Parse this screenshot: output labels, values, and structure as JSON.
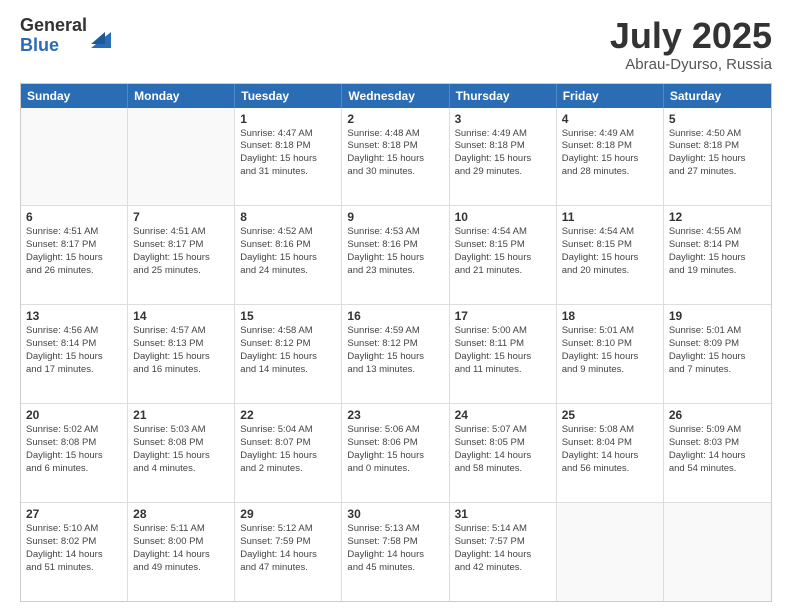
{
  "logo": {
    "general": "General",
    "blue": "Blue"
  },
  "title": {
    "month_year": "July 2025",
    "location": "Abrau-Dyurso, Russia"
  },
  "header_days": [
    "Sunday",
    "Monday",
    "Tuesday",
    "Wednesday",
    "Thursday",
    "Friday",
    "Saturday"
  ],
  "weeks": [
    [
      {
        "day": "",
        "info": ""
      },
      {
        "day": "",
        "info": ""
      },
      {
        "day": "1",
        "info": "Sunrise: 4:47 AM\nSunset: 8:18 PM\nDaylight: 15 hours\nand 31 minutes."
      },
      {
        "day": "2",
        "info": "Sunrise: 4:48 AM\nSunset: 8:18 PM\nDaylight: 15 hours\nand 30 minutes."
      },
      {
        "day": "3",
        "info": "Sunrise: 4:49 AM\nSunset: 8:18 PM\nDaylight: 15 hours\nand 29 minutes."
      },
      {
        "day": "4",
        "info": "Sunrise: 4:49 AM\nSunset: 8:18 PM\nDaylight: 15 hours\nand 28 minutes."
      },
      {
        "day": "5",
        "info": "Sunrise: 4:50 AM\nSunset: 8:18 PM\nDaylight: 15 hours\nand 27 minutes."
      }
    ],
    [
      {
        "day": "6",
        "info": "Sunrise: 4:51 AM\nSunset: 8:17 PM\nDaylight: 15 hours\nand 26 minutes."
      },
      {
        "day": "7",
        "info": "Sunrise: 4:51 AM\nSunset: 8:17 PM\nDaylight: 15 hours\nand 25 minutes."
      },
      {
        "day": "8",
        "info": "Sunrise: 4:52 AM\nSunset: 8:16 PM\nDaylight: 15 hours\nand 24 minutes."
      },
      {
        "day": "9",
        "info": "Sunrise: 4:53 AM\nSunset: 8:16 PM\nDaylight: 15 hours\nand 23 minutes."
      },
      {
        "day": "10",
        "info": "Sunrise: 4:54 AM\nSunset: 8:15 PM\nDaylight: 15 hours\nand 21 minutes."
      },
      {
        "day": "11",
        "info": "Sunrise: 4:54 AM\nSunset: 8:15 PM\nDaylight: 15 hours\nand 20 minutes."
      },
      {
        "day": "12",
        "info": "Sunrise: 4:55 AM\nSunset: 8:14 PM\nDaylight: 15 hours\nand 19 minutes."
      }
    ],
    [
      {
        "day": "13",
        "info": "Sunrise: 4:56 AM\nSunset: 8:14 PM\nDaylight: 15 hours\nand 17 minutes."
      },
      {
        "day": "14",
        "info": "Sunrise: 4:57 AM\nSunset: 8:13 PM\nDaylight: 15 hours\nand 16 minutes."
      },
      {
        "day": "15",
        "info": "Sunrise: 4:58 AM\nSunset: 8:12 PM\nDaylight: 15 hours\nand 14 minutes."
      },
      {
        "day": "16",
        "info": "Sunrise: 4:59 AM\nSunset: 8:12 PM\nDaylight: 15 hours\nand 13 minutes."
      },
      {
        "day": "17",
        "info": "Sunrise: 5:00 AM\nSunset: 8:11 PM\nDaylight: 15 hours\nand 11 minutes."
      },
      {
        "day": "18",
        "info": "Sunrise: 5:01 AM\nSunset: 8:10 PM\nDaylight: 15 hours\nand 9 minutes."
      },
      {
        "day": "19",
        "info": "Sunrise: 5:01 AM\nSunset: 8:09 PM\nDaylight: 15 hours\nand 7 minutes."
      }
    ],
    [
      {
        "day": "20",
        "info": "Sunrise: 5:02 AM\nSunset: 8:08 PM\nDaylight: 15 hours\nand 6 minutes."
      },
      {
        "day": "21",
        "info": "Sunrise: 5:03 AM\nSunset: 8:08 PM\nDaylight: 15 hours\nand 4 minutes."
      },
      {
        "day": "22",
        "info": "Sunrise: 5:04 AM\nSunset: 8:07 PM\nDaylight: 15 hours\nand 2 minutes."
      },
      {
        "day": "23",
        "info": "Sunrise: 5:06 AM\nSunset: 8:06 PM\nDaylight: 15 hours\nand 0 minutes."
      },
      {
        "day": "24",
        "info": "Sunrise: 5:07 AM\nSunset: 8:05 PM\nDaylight: 14 hours\nand 58 minutes."
      },
      {
        "day": "25",
        "info": "Sunrise: 5:08 AM\nSunset: 8:04 PM\nDaylight: 14 hours\nand 56 minutes."
      },
      {
        "day": "26",
        "info": "Sunrise: 5:09 AM\nSunset: 8:03 PM\nDaylight: 14 hours\nand 54 minutes."
      }
    ],
    [
      {
        "day": "27",
        "info": "Sunrise: 5:10 AM\nSunset: 8:02 PM\nDaylight: 14 hours\nand 51 minutes."
      },
      {
        "day": "28",
        "info": "Sunrise: 5:11 AM\nSunset: 8:00 PM\nDaylight: 14 hours\nand 49 minutes."
      },
      {
        "day": "29",
        "info": "Sunrise: 5:12 AM\nSunset: 7:59 PM\nDaylight: 14 hours\nand 47 minutes."
      },
      {
        "day": "30",
        "info": "Sunrise: 5:13 AM\nSunset: 7:58 PM\nDaylight: 14 hours\nand 45 minutes."
      },
      {
        "day": "31",
        "info": "Sunrise: 5:14 AM\nSunset: 7:57 PM\nDaylight: 14 hours\nand 42 minutes."
      },
      {
        "day": "",
        "info": ""
      },
      {
        "day": "",
        "info": ""
      }
    ]
  ]
}
